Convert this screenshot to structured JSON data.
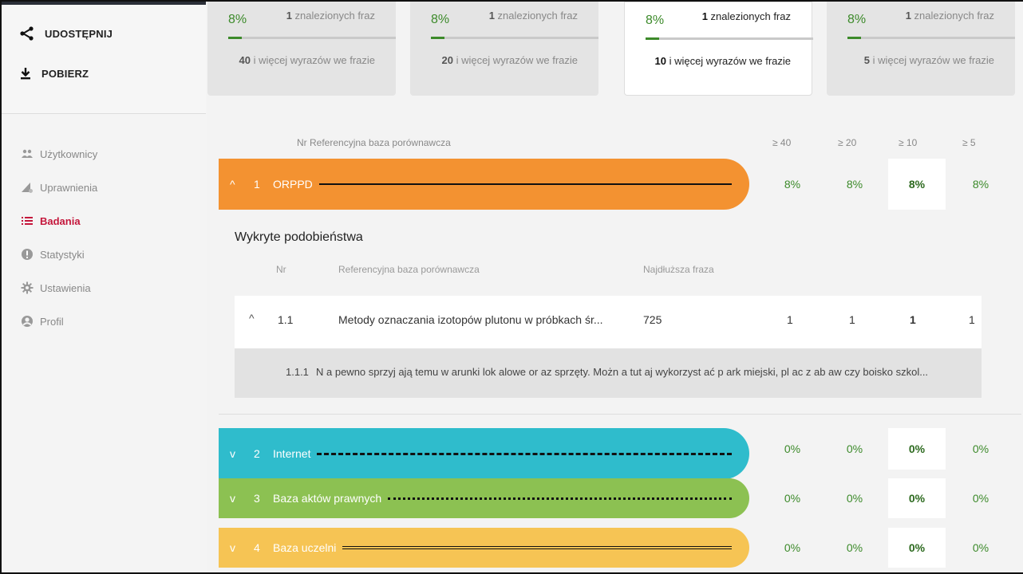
{
  "sidebar": {
    "share_label": "UDOSTĘPNIJ",
    "download_label": "POBIERZ",
    "items": [
      {
        "label": "Użytkownicy",
        "icon": "users-icon"
      },
      {
        "label": "Uprawnienia",
        "icon": "permissions-icon"
      },
      {
        "label": "Badania",
        "icon": "list-icon",
        "active": true
      },
      {
        "label": "Statystyki",
        "icon": "info-icon"
      },
      {
        "label": "Ustawienia",
        "icon": "gear-icon"
      },
      {
        "label": "Profil",
        "icon": "profile-icon"
      }
    ]
  },
  "cards": [
    {
      "pct": "8%",
      "found_count": "1",
      "found_text": " znalezionych fraz",
      "words_count": "40",
      "words_text": " i więcej wyrazów we frazie",
      "progress": 0.08
    },
    {
      "pct": "8%",
      "found_count": "1",
      "found_text": " znalezionych fraz",
      "words_count": "20",
      "words_text": " i więcej wyrazów we frazie",
      "progress": 0.08
    },
    {
      "pct": "8%",
      "found_count": "1",
      "found_text": " znalezionych fraz",
      "words_count": "10",
      "words_text": " i więcej wyrazów we frazie",
      "progress": 0.08,
      "selected": true
    },
    {
      "pct": "8%",
      "found_count": "1",
      "found_text": " znalezionych fraz",
      "words_count": "5",
      "words_text": " i więcej wyrazów we frazie",
      "progress": 0.08
    }
  ],
  "table_header": {
    "nr_ref": "Nr Referencyjna baza porównawcza",
    "c40": "≥ 40",
    "c20": "≥ 20",
    "c10": "≥ 10",
    "c5": "≥ 5"
  },
  "databases": [
    {
      "num": "1",
      "name": "ORPPD",
      "chevron": "^",
      "color": "#f39231",
      "line_style": "solid",
      "values": [
        "8%",
        "8%",
        "8%",
        "8%"
      ]
    },
    {
      "num": "2",
      "name": "Internet",
      "chevron": "v",
      "color": "#2fbccc",
      "line_style": "dashed",
      "values": [
        "0%",
        "0%",
        "0%",
        "0%"
      ]
    },
    {
      "num": "3",
      "name": "Baza aktów prawnych",
      "chevron": "v",
      "color": "#8cc152",
      "line_style": "dotted",
      "values": [
        "0%",
        "0%",
        "0%",
        "0%"
      ]
    },
    {
      "num": "4",
      "name": "Baza uczelni",
      "chevron": "v",
      "color": "#f6c454",
      "line_style": "double",
      "values": [
        "0%",
        "0%",
        "0%",
        "0%"
      ]
    }
  ],
  "detail": {
    "title": "Wykryte podobieństwa",
    "col_nr": "Nr",
    "col_ref": "Referencyjna baza porównawcza",
    "col_longest": "Najdłuższa fraza",
    "row": {
      "num": "1.1",
      "title": "Metody oznaczania izotopów plutonu w próbkach śr...",
      "longest": "725",
      "v40": "1",
      "v20": "1",
      "v10": "1",
      "v5": "1"
    },
    "subrow": {
      "num": "1.1.1",
      "text": "N a pewno sprzyj ają temu w arunki lok alowe or az sprzęty. Możn a tut aj wykorzyst ać p ark miejski, pl ac z ab aw czy boisko szkol..."
    }
  }
}
